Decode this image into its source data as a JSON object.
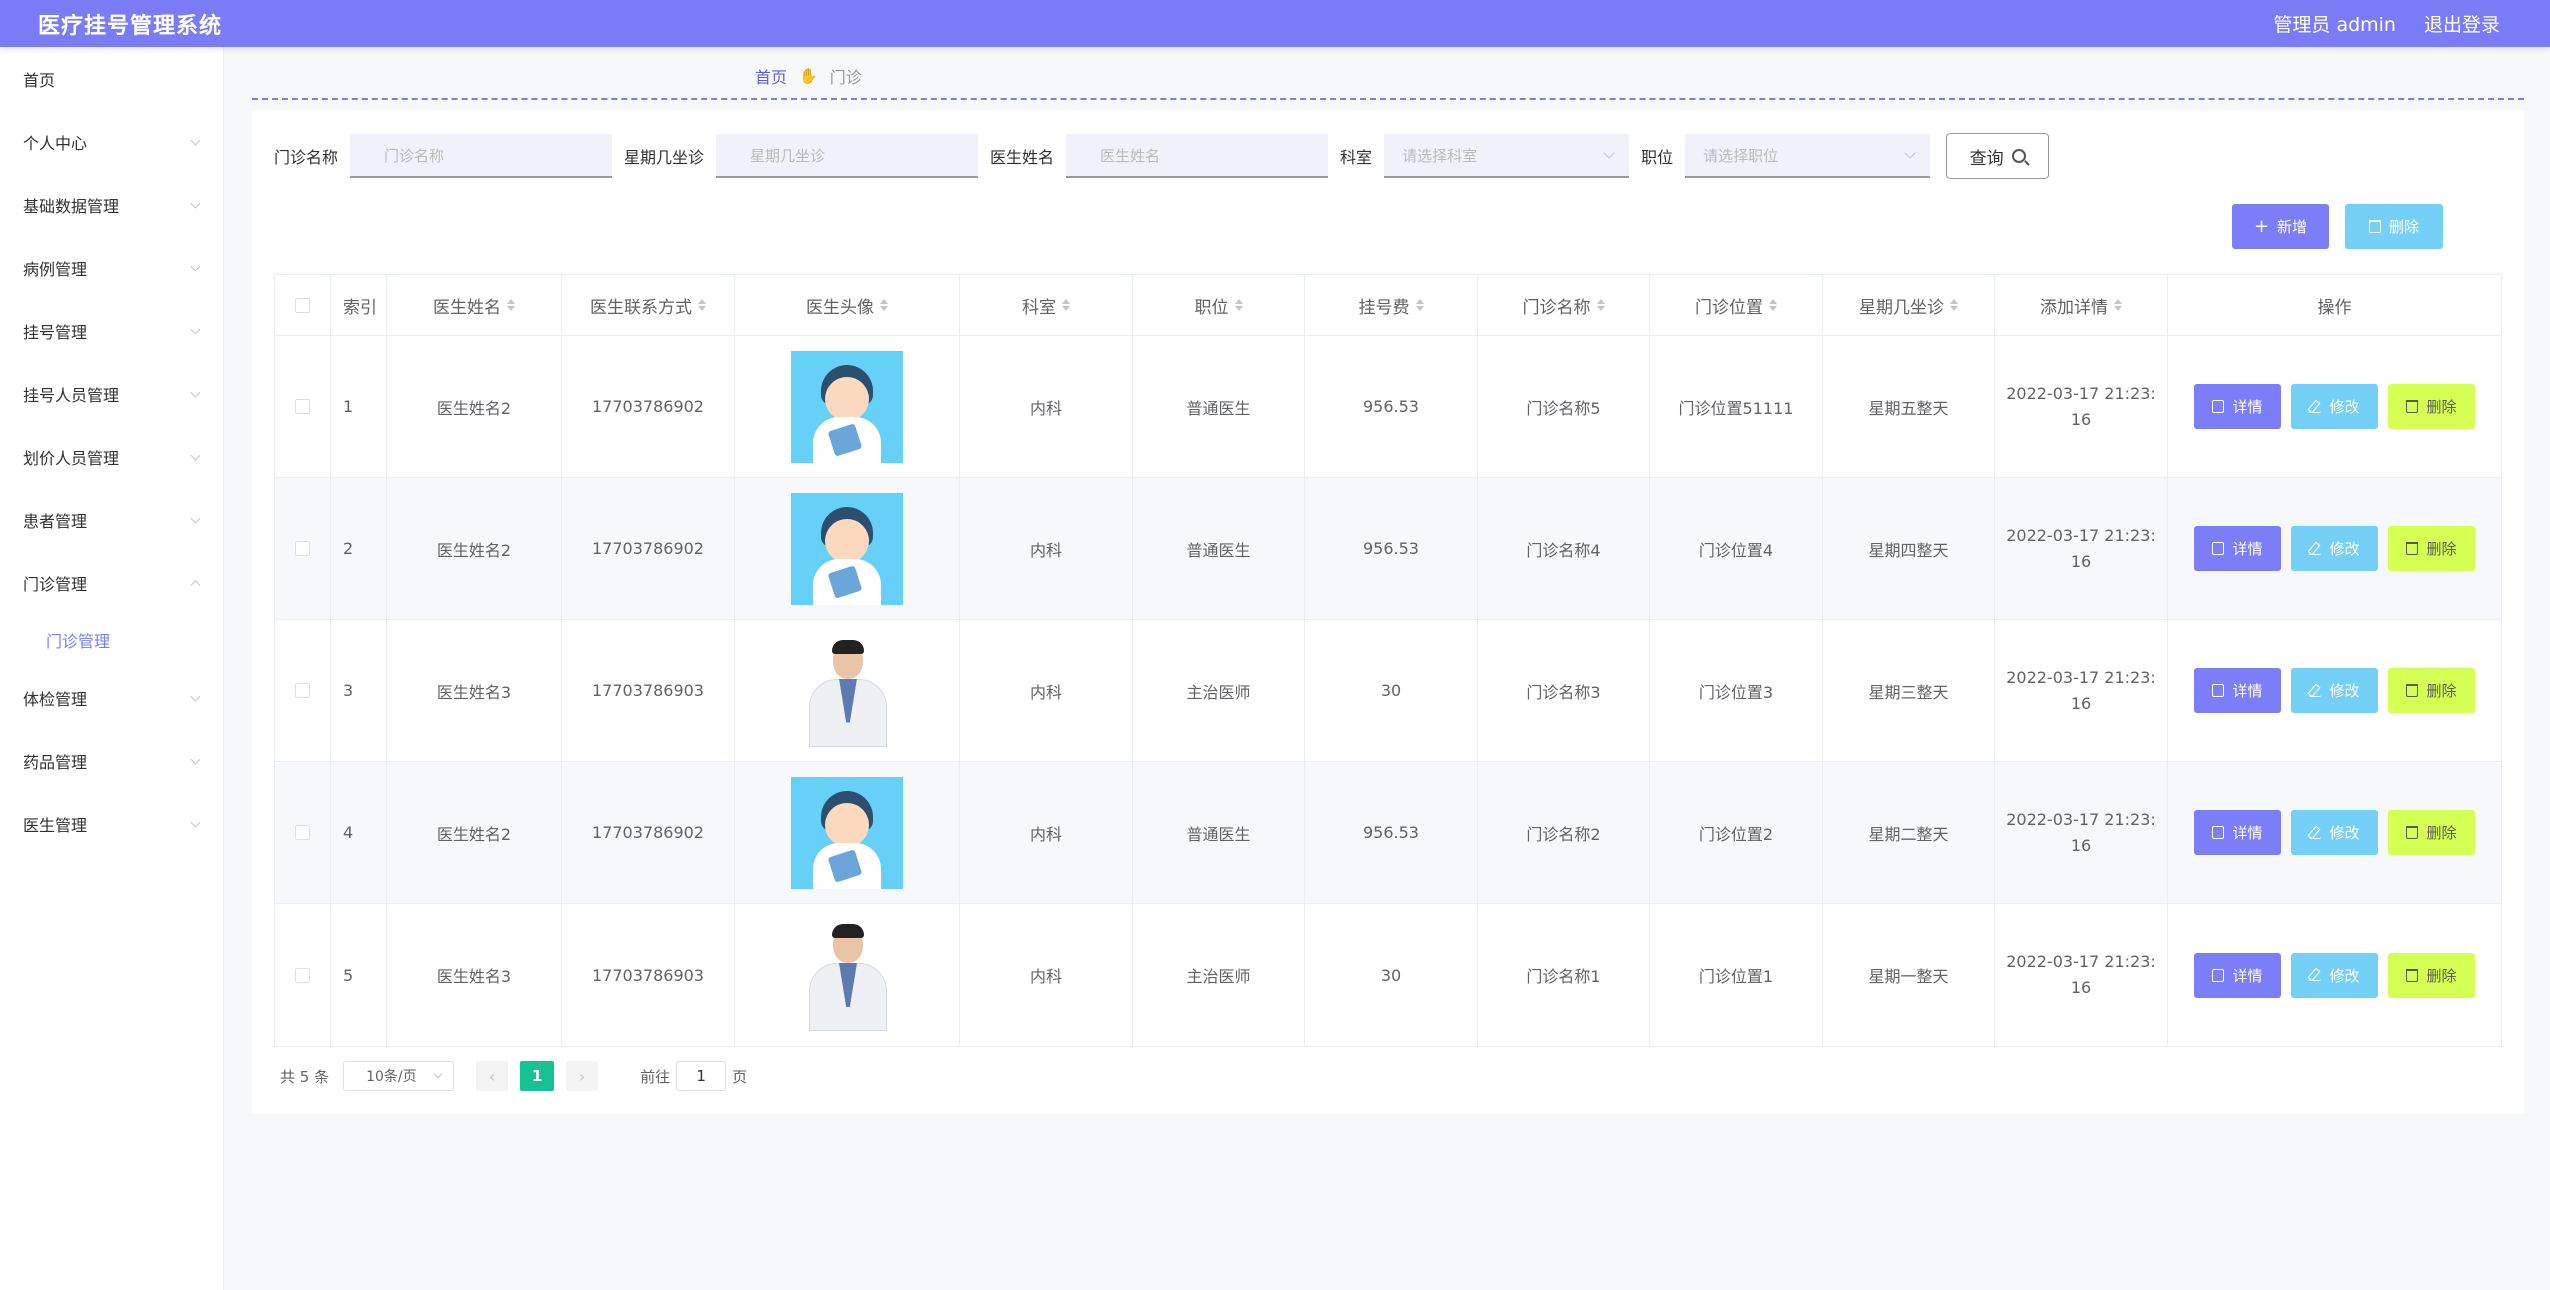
{
  "header": {
    "title": "医疗挂号管理系统",
    "user_label": "管理员 admin",
    "logout_label": "退出登录"
  },
  "sidebar": {
    "items": [
      {
        "label": "首页",
        "has_children": false
      },
      {
        "label": "个人中心",
        "has_children": true
      },
      {
        "label": "基础数据管理",
        "has_children": true
      },
      {
        "label": "病例管理",
        "has_children": true
      },
      {
        "label": "挂号管理",
        "has_children": true
      },
      {
        "label": "挂号人员管理",
        "has_children": true
      },
      {
        "label": "划价人员管理",
        "has_children": true
      },
      {
        "label": "患者管理",
        "has_children": true
      },
      {
        "label": "门诊管理",
        "has_children": true,
        "expanded": true
      },
      {
        "label": "体检管理",
        "has_children": true
      },
      {
        "label": "药品管理",
        "has_children": true
      },
      {
        "label": "医生管理",
        "has_children": true
      }
    ],
    "active_sub": "门诊管理"
  },
  "breadcrumb": {
    "home": "首页",
    "current": "门诊"
  },
  "search": {
    "clinic_name_label": "门诊名称",
    "clinic_name_placeholder": "门诊名称",
    "weekday_label": "星期几坐诊",
    "weekday_placeholder": "星期几坐诊",
    "doctor_name_label": "医生姓名",
    "doctor_name_placeholder": "医生姓名",
    "department_label": "科室",
    "department_placeholder": "请选择科室",
    "position_label": "职位",
    "position_placeholder": "请选择职位",
    "query_label": "查询"
  },
  "toolbar": {
    "add_label": "新增",
    "delete_label": "删除"
  },
  "table": {
    "columns": [
      "索引",
      "医生姓名",
      "医生联系方式",
      "医生头像",
      "科室",
      "职位",
      "挂号费",
      "门诊名称",
      "门诊位置",
      "星期几坐诊",
      "添加详情",
      "操作"
    ],
    "rows": [
      {
        "index": "1",
        "name": "医生姓名2",
        "phone": "17703786902",
        "avatar": "cartoon-doctor",
        "dept": "内科",
        "position": "普通医生",
        "fee": "956.53",
        "clinic": "门诊名称5",
        "location": "门诊位置51111",
        "weekday": "星期五整天",
        "added": "2022-03-17 21:23:16"
      },
      {
        "index": "2",
        "name": "医生姓名2",
        "phone": "17703786902",
        "avatar": "cartoon-doctor",
        "dept": "内科",
        "position": "普通医生",
        "fee": "956.53",
        "clinic": "门诊名称4",
        "location": "门诊位置4",
        "weekday": "星期四整天",
        "added": "2022-03-17 21:23:16"
      },
      {
        "index": "3",
        "name": "医生姓名3",
        "phone": "17703786903",
        "avatar": "photo-doctor",
        "dept": "内科",
        "position": "主治医师",
        "fee": "30",
        "clinic": "门诊名称3",
        "location": "门诊位置3",
        "weekday": "星期三整天",
        "added": "2022-03-17 21:23:16"
      },
      {
        "index": "4",
        "name": "医生姓名2",
        "phone": "17703786902",
        "avatar": "cartoon-doctor",
        "dept": "内科",
        "position": "普通医生",
        "fee": "956.53",
        "clinic": "门诊名称2",
        "location": "门诊位置2",
        "weekday": "星期二整天",
        "added": "2022-03-17 21:23:16"
      },
      {
        "index": "5",
        "name": "医生姓名3",
        "phone": "17703786903",
        "avatar": "photo-doctor",
        "dept": "内科",
        "position": "主治医师",
        "fee": "30",
        "clinic": "门诊名称1",
        "location": "门诊位置1",
        "weekday": "星期一整天",
        "added": "2022-03-17 21:23:16"
      }
    ],
    "actions": {
      "detail": "详情",
      "edit": "修改",
      "delete": "删除"
    }
  },
  "pagination": {
    "total": "共 5 条",
    "page_size": "10条/页",
    "current_page": "1",
    "goto_prefix": "前往",
    "goto_value": "1",
    "goto_suffix": "页"
  },
  "colors": {
    "primary": "#7a7cf6",
    "info": "#74d0f7",
    "lime": "#d6ff54",
    "pager_active": "#17c192"
  }
}
